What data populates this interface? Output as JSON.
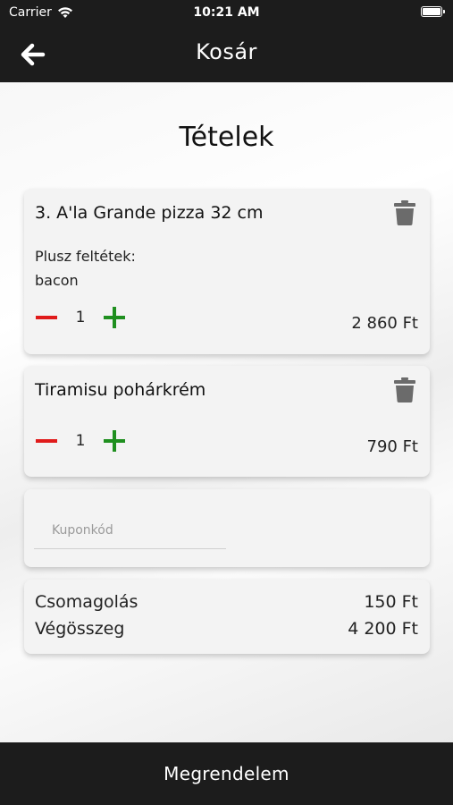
{
  "status_bar": {
    "carrier": "Carrier",
    "time": "10:21 AM"
  },
  "nav": {
    "title": "Kosár"
  },
  "section_title": "Tételek",
  "cart_items": [
    {
      "name": "3. A'la Grande pizza 32 cm",
      "extras_label": "Plusz feltétek:",
      "extras_value": "bacon",
      "quantity": "1",
      "price": "2 860 Ft"
    },
    {
      "name": "Tiramisu pohárkrém",
      "quantity": "1",
      "price": "790 Ft"
    }
  ],
  "coupon": {
    "placeholder": "Kuponkód",
    "value": ""
  },
  "totals": {
    "packaging_label": "Csomagolás",
    "packaging_value": "150 Ft",
    "total_label": "Végösszeg",
    "total_value": "4 200 Ft"
  },
  "order_button": "Megrendelem",
  "colors": {
    "bar": "#1c1c1c",
    "minus": "#e01b1b",
    "plus": "#1f8f1f",
    "card": "#f3f3f3"
  }
}
